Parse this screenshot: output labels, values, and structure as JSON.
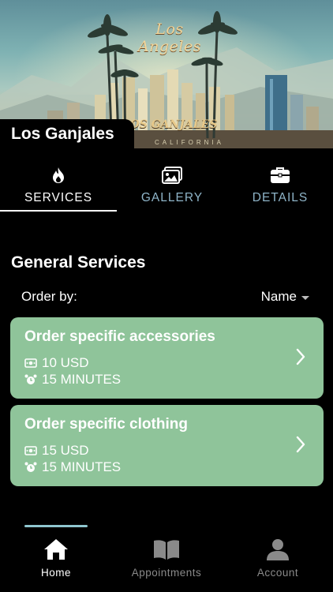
{
  "hero": {
    "title": "Los Angeles",
    "banner": "LOS GANJALES",
    "caption": "CALIFORNIA"
  },
  "store": {
    "name": "Los Ganjales"
  },
  "tabs": [
    {
      "label": "SERVICES",
      "icon": "flame-icon",
      "active": true
    },
    {
      "label": "GALLERY",
      "icon": "image-gallery-icon",
      "active": false
    },
    {
      "label": "DETAILS",
      "icon": "briefcase-icon",
      "active": false
    }
  ],
  "section": {
    "title": "General Services",
    "order_label": "Order by:",
    "sort_value": "Name"
  },
  "services": [
    {
      "name": "Order specific accessories",
      "price": "10 USD",
      "duration": "15 MINUTES"
    },
    {
      "name": "Order specific clothing",
      "price": "15 USD",
      "duration": "15 MINUTES"
    }
  ],
  "nav": [
    {
      "label": "Home",
      "icon": "home-icon",
      "active": true
    },
    {
      "label": "Appointments",
      "icon": "book-icon",
      "active": false
    },
    {
      "label": "Account",
      "icon": "user-icon",
      "active": false
    }
  ],
  "colors": {
    "card": "#8fc49a",
    "tab_inactive": "#8fb5c9",
    "nav_indicator": "#8fc6cf",
    "background": "#000000"
  }
}
